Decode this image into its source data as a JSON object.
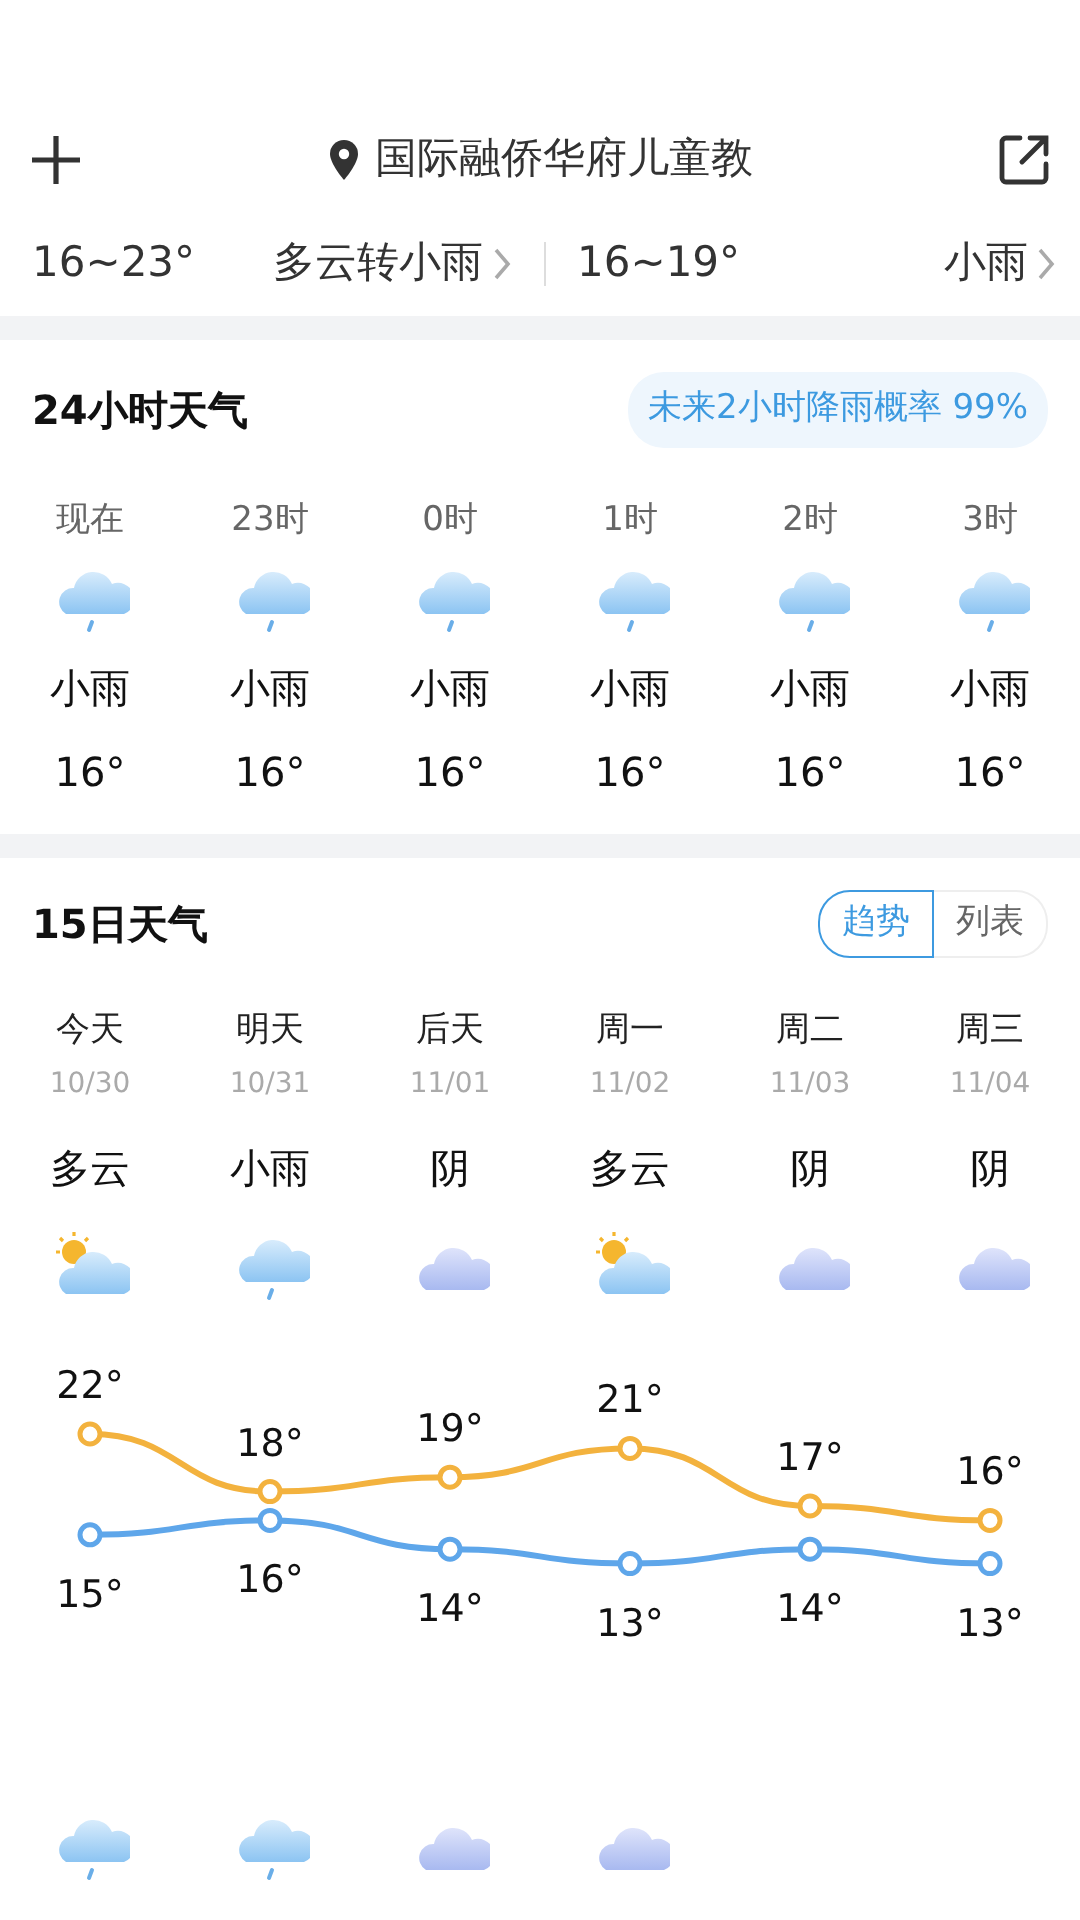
{
  "header": {
    "location": "国际融侨华府儿童教"
  },
  "summary": [
    {
      "temp": "16~23°",
      "condition": "多云转小雨"
    },
    {
      "temp": "16~19°",
      "condition": "小雨"
    }
  ],
  "hourly": {
    "title": "24小时天气",
    "rain_chance": "未来2小时降雨概率 99%",
    "hours": [
      {
        "time": "现在",
        "kind": "rain",
        "condition": "小雨",
        "temp": "16°"
      },
      {
        "time": "23时",
        "kind": "rain",
        "condition": "小雨",
        "temp": "16°"
      },
      {
        "time": "0时",
        "kind": "rain",
        "condition": "小雨",
        "temp": "16°"
      },
      {
        "time": "1时",
        "kind": "rain",
        "condition": "小雨",
        "temp": "16°"
      },
      {
        "time": "2时",
        "kind": "rain",
        "condition": "小雨",
        "temp": "16°"
      },
      {
        "time": "3时",
        "kind": "rain",
        "condition": "小雨",
        "temp": "16°"
      }
    ]
  },
  "daily": {
    "title": "15日天气",
    "views": [
      {
        "label": "趋势",
        "selected": true
      },
      {
        "label": "列表",
        "selected": false
      }
    ],
    "days": [
      {
        "day": "今天",
        "date": "10/30",
        "condition": "多云",
        "kind": "partly-cloudy",
        "night": {
          "kind": "rain"
        }
      },
      {
        "day": "明天",
        "date": "10/31",
        "condition": "小雨",
        "kind": "rain",
        "night": {
          "kind": "rain"
        }
      },
      {
        "day": "后天",
        "date": "11/01",
        "condition": "阴",
        "kind": "overcast",
        "night": {
          "kind": "overcast"
        }
      },
      {
        "day": "周一",
        "date": "11/02",
        "condition": "多云",
        "kind": "partly-cloudy",
        "night": {
          "kind": "overcast"
        }
      },
      {
        "day": "周二",
        "date": "11/03",
        "condition": "阴",
        "kind": "overcast"
      },
      {
        "day": "周三",
        "date": "11/04",
        "condition": "阴",
        "kind": "overcast"
      }
    ],
    "chart_data": {
      "type": "line",
      "data_labels": true,
      "series": [
        {
          "color": "#f3b23e",
          "marker": "circle",
          "values": [
            22,
            18,
            19,
            21,
            17,
            16
          ],
          "value_labels": [
            "22°",
            "18°",
            "19°",
            "21°",
            "17°",
            "16°"
          ]
        },
        {
          "color": "#5ea6ea",
          "marker": "circle",
          "values": [
            15,
            16,
            14,
            13,
            14,
            13
          ],
          "value_labels": [
            "15°",
            "16°",
            "14°",
            "13°",
            "14°",
            "13°"
          ]
        }
      ]
    }
  }
}
